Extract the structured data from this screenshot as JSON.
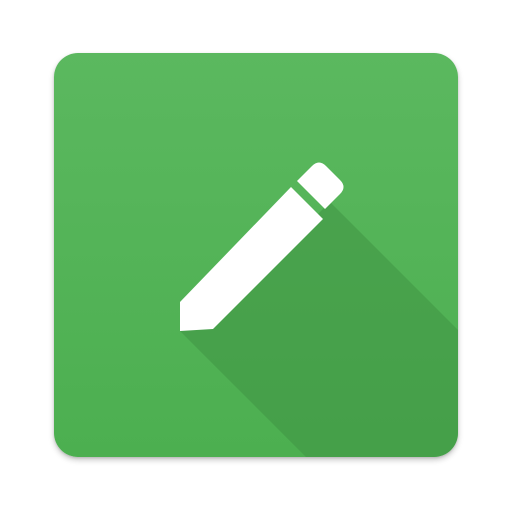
{
  "icon": {
    "name": "pencil-icon",
    "colors": {
      "tile": "#4caf50",
      "tile_highlight": "#5bb85f",
      "long_shadow": "#3f9443",
      "pencil": "#ffffff",
      "pencil_eraser_gap": "#4caf50"
    }
  }
}
